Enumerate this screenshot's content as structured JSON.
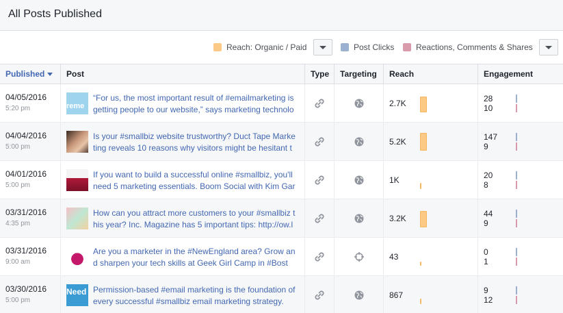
{
  "header": {
    "title": "All Posts Published"
  },
  "legend": {
    "items": [
      {
        "label": "Reach: Organic / Paid",
        "color": "#fcc986"
      },
      {
        "label": "Post Clicks",
        "color": "#9cb0d1"
      },
      {
        "label": "Reactions, Comments & Shares",
        "color": "#d99aac"
      }
    ]
  },
  "table": {
    "columns": [
      "Published",
      "Post",
      "Type",
      "Targeting",
      "Reach",
      "Engagement"
    ],
    "rows": [
      {
        "date": "04/05/2016",
        "time": "5:20 pm",
        "text": "“For us, the most important result of #emailmarketing is getting people to our website,” says marketing technolo",
        "thumb": "reme",
        "type": "link-icon",
        "targeting": "globe-icon",
        "reach": "2.7K",
        "reach_level": 0.85,
        "clicks": "28",
        "reactions": "10"
      },
      {
        "date": "04/04/2016",
        "time": "5:00 pm",
        "text": "Is your #smallbiz website trustworthy? Duct Tape Marketing reveals 10 reasons why visitors might be hesitant t",
        "thumb": "",
        "type": "link-icon",
        "targeting": "globe-icon",
        "reach": "5.2K",
        "reach_level": 1.0,
        "clicks": "147",
        "reactions": "9"
      },
      {
        "date": "04/01/2016",
        "time": "5:00 pm",
        "text": "If you want to build a successful online #smallbiz, you'll need 5 marketing essentials. Boom Social with Kim Gar",
        "thumb": "",
        "type": "link-icon",
        "targeting": "globe-icon",
        "reach": "1K",
        "reach_level": 0.2,
        "clicks": "20",
        "reactions": "8"
      },
      {
        "date": "03/31/2016",
        "time": "4:35 pm",
        "text": "How can you attract more customers to your #smallbiz this year? Inc. Magazine has 5 important tips: http://ow.l",
        "thumb": "",
        "type": "link-icon",
        "targeting": "globe-icon",
        "reach": "3.2K",
        "reach_level": 0.9,
        "clicks": "44",
        "reactions": "9"
      },
      {
        "date": "03/31/2016",
        "time": "9:00 am",
        "text": "Are you a marketer in the #NewEngland area? Grow and sharpen your tech skills at Geek Girl Camp in #Bost",
        "thumb": "",
        "type": "link-icon",
        "targeting": "crosshair-icon",
        "reach": "43",
        "reach_level": 0.05,
        "clicks": "0",
        "reactions": "1"
      },
      {
        "date": "03/30/2016",
        "time": "5:00 pm",
        "text": "Permission-based #email marketing is the foundation of every successful #smallbiz email marketing strategy.",
        "thumb": "Need",
        "type": "link-icon",
        "targeting": "globe-icon",
        "reach": "867",
        "reach_level": 0.15,
        "clicks": "9",
        "reactions": "12"
      }
    ]
  }
}
